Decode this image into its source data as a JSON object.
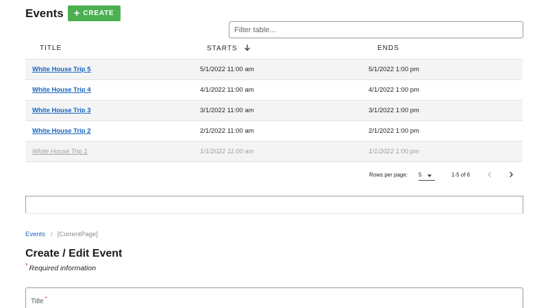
{
  "header": {
    "title": "Events",
    "create_label": "CREATE"
  },
  "filter": {
    "placeholder": "Filter table..."
  },
  "table": {
    "columns": {
      "title": "TITLE",
      "starts": "STARTS",
      "ends": "ENDS"
    },
    "rows": [
      {
        "title": "White House Trip 5",
        "starts": "5/1/2022 11:00 am",
        "ends": "5/1/2022 1:00 pm",
        "shaded": true,
        "disabled": false
      },
      {
        "title": "White House Trip 4",
        "starts": "4/1/2022 11:00 am",
        "ends": "4/1/2022 1:00 pm",
        "shaded": false,
        "disabled": false
      },
      {
        "title": "White House Trip 3",
        "starts": "3/1/2022 11:00 am",
        "ends": "3/1/2022 1:00 pm",
        "shaded": true,
        "disabled": false
      },
      {
        "title": "White House Trip 2",
        "starts": "2/1/2022 11:00 am",
        "ends": "2/1/2022 1:00 pm",
        "shaded": false,
        "disabled": false
      },
      {
        "title": "White House Trip 1",
        "starts": "1/1/2022 11:00 am",
        "ends": "1/1/2022 1:00 pm",
        "shaded": true,
        "disabled": true
      }
    ]
  },
  "pagination": {
    "rows_per_page_label": "Rows per page:",
    "rows_per_page_value": "5",
    "range": "1-5 of 6"
  },
  "breadcrumb": {
    "link": "Events",
    "separator": "/",
    "current": "[CurrentPage]"
  },
  "form": {
    "title": "Create / Edit Event",
    "required_star": "*",
    "required_note": "Required information",
    "title_field_label": "Title",
    "title_field_star": "*"
  },
  "colors": {
    "accent_green": "#4caf50",
    "link_blue": "#1565c0",
    "required_red": "#d32f2f"
  },
  "icons": {
    "create": "plus-icon",
    "sort": "arrow-down-icon",
    "rows_per_page": "caret-down-icon",
    "prev_page": "chevron-left-icon",
    "next_page": "chevron-right-icon"
  }
}
